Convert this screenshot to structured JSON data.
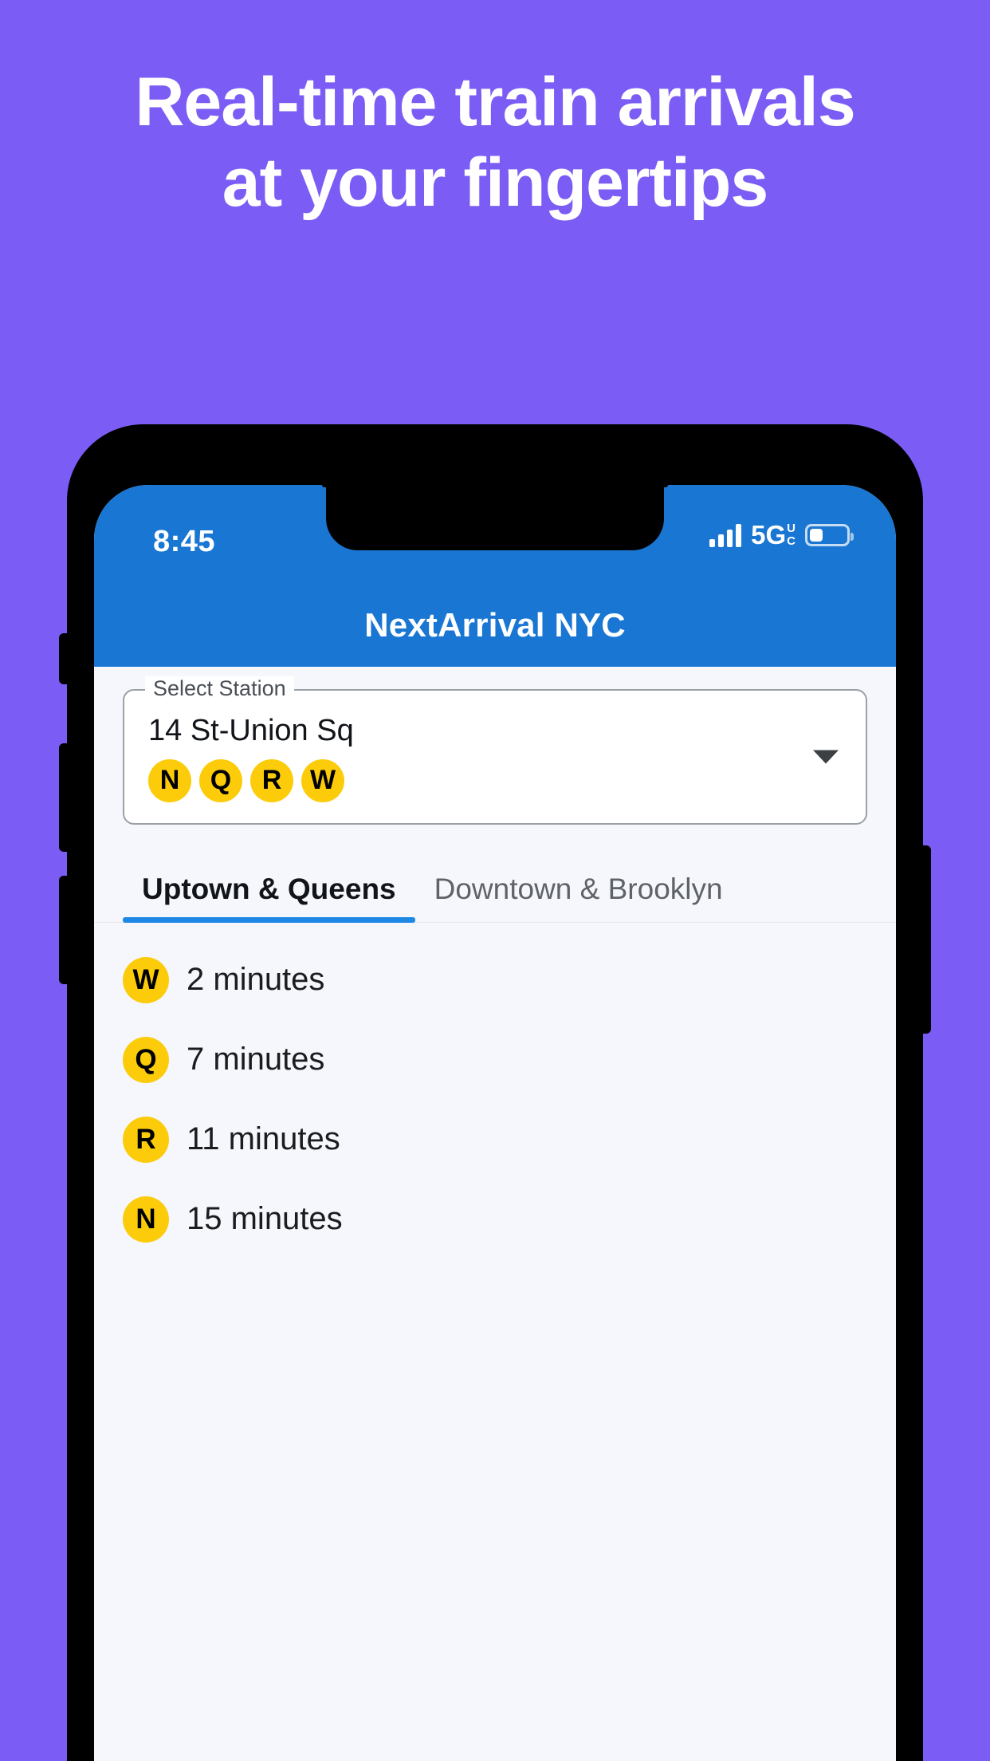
{
  "promo": {
    "headline": "Real-time train arrivals at your fingertips",
    "background_color": "#7B5CF5",
    "text_color": "#FFFFFF"
  },
  "phone": {
    "status_bar": {
      "time": "8:45",
      "signal_icon": "signal-bars-icon",
      "network_label": "5G",
      "network_sup": "U",
      "network_sub": "C",
      "battery_icon": "battery-icon",
      "battery_level_percent": 36,
      "background_color": "#1976D2"
    },
    "app_bar": {
      "title": "NextArrival NYC",
      "background_color": "#1976D2"
    }
  },
  "station_selector": {
    "legend": "Select Station",
    "value": "14 St-Union Sq",
    "lines": [
      "N",
      "Q",
      "R",
      "W"
    ],
    "line_badge_color": "#FCCC0A",
    "dropdown_icon": "chevron-down-icon"
  },
  "tabs": [
    {
      "label": "Uptown & Queens",
      "active": true
    },
    {
      "label": "Downtown & Brooklyn",
      "active": false
    }
  ],
  "tab_indicator_color": "#1E88E5",
  "arrivals": [
    {
      "line": "W",
      "time": "2 minutes"
    },
    {
      "line": "Q",
      "time": "7 minutes"
    },
    {
      "line": "R",
      "time": "11 minutes"
    },
    {
      "line": "N",
      "time": "15 minutes"
    }
  ]
}
